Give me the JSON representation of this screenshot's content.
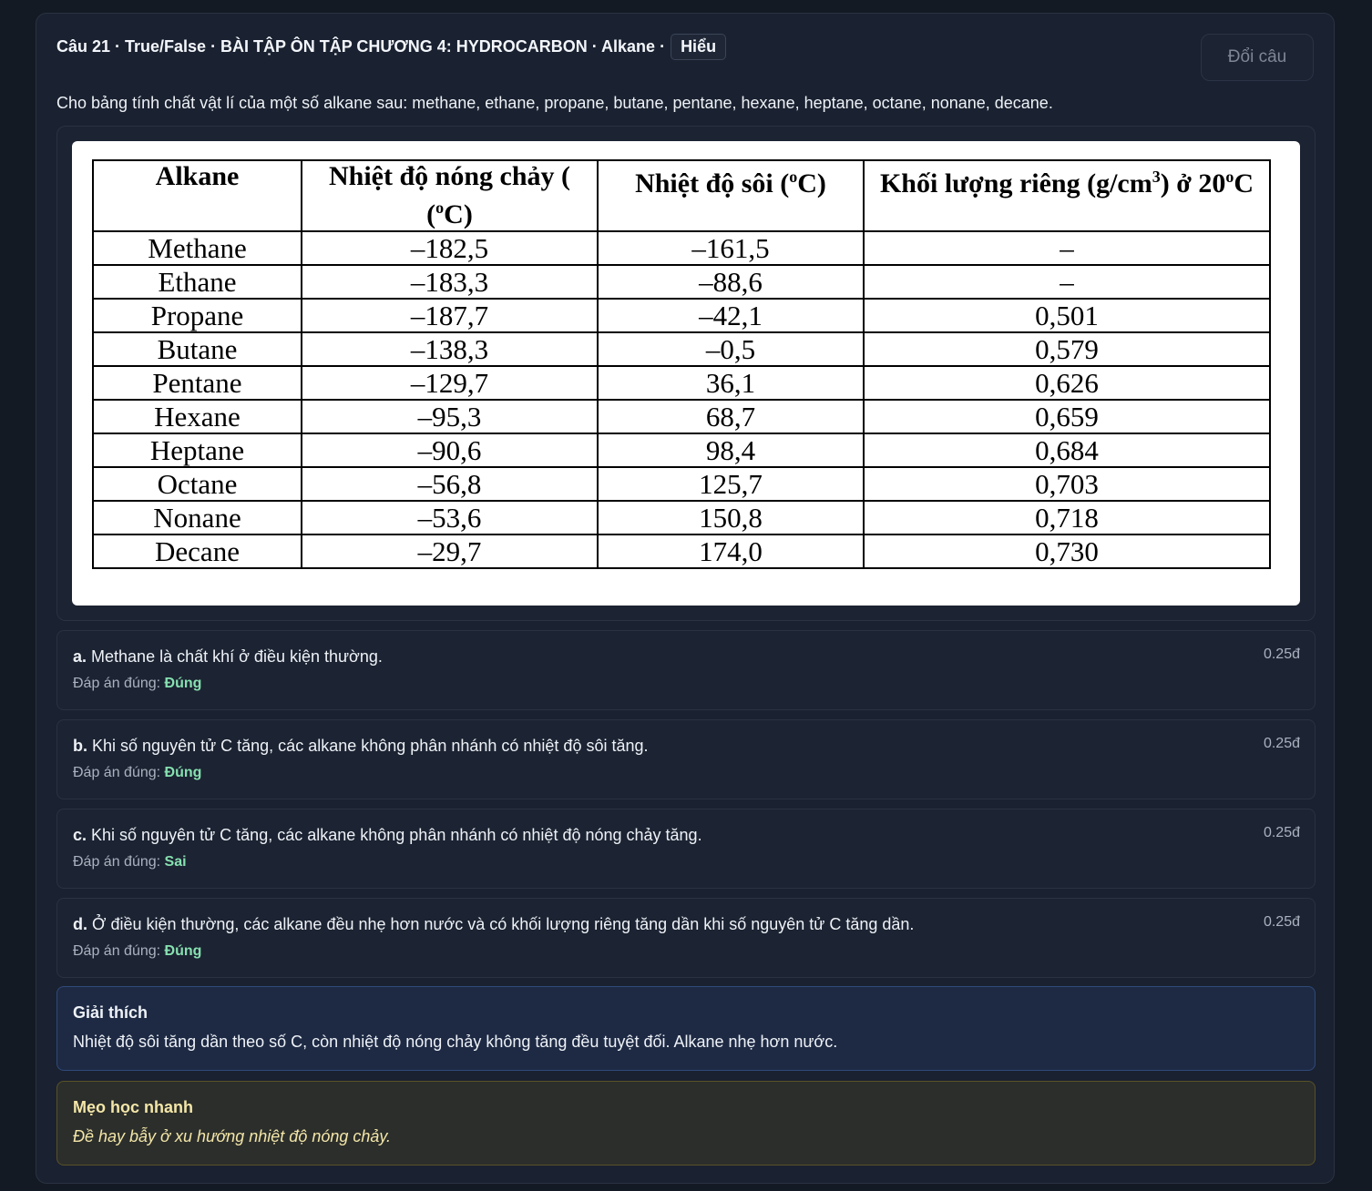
{
  "header": {
    "title": "Câu 21 · True/False · BÀI TẬP ÔN TẬP CHƯƠNG 4: HYDROCARBON · Alkane ·",
    "level_badge": "Hiểu",
    "swap_button": "Đổi câu"
  },
  "prompt": "Cho bảng tính chất vật lí của một số alkane sau: methane, ethane, propane, butane, pentane, hexane, heptane, octane, nonane, decane.",
  "table": {
    "headers": [
      "Alkane",
      "Nhiệt độ nóng chảy (",
      "oC)",
      "Nhiệt độ sôi (",
      "oC)",
      "Khối lượng riêng (g/cm",
      "3",
      ") ở 20",
      "o",
      "C"
    ],
    "rows": [
      [
        "Methane",
        "–182,5",
        "–161,5",
        "–"
      ],
      [
        "Ethane",
        "–183,3",
        "–88,6",
        "–"
      ],
      [
        "Propane",
        "–187,7",
        "–42,1",
        "0,501"
      ],
      [
        "Butane",
        "–138,3",
        "–0,5",
        "0,579"
      ],
      [
        "Pentane",
        "–129,7",
        "36,1",
        "0,626"
      ],
      [
        "Hexane",
        "–95,3",
        "68,7",
        "0,659"
      ],
      [
        "Heptane",
        "–90,6",
        "98,4",
        "0,684"
      ],
      [
        "Octane",
        "–56,8",
        "125,7",
        "0,703"
      ],
      [
        "Nonane",
        "–53,6",
        "150,8",
        "0,718"
      ],
      [
        "Decane",
        "–29,7",
        "174,0",
        "0,730"
      ]
    ]
  },
  "statements": [
    {
      "letter": "a.",
      "text": "Methane là chất khí ở điều kiện thường.",
      "answer_label": "Đáp án đúng:",
      "answer": "Đúng",
      "points": "0.25đ"
    },
    {
      "letter": "b.",
      "text": "Khi số nguyên tử C tăng, các alkane không phân nhánh có nhiệt độ sôi tăng.",
      "answer_label": "Đáp án đúng:",
      "answer": "Đúng",
      "points": "0.25đ"
    },
    {
      "letter": "c.",
      "text": "Khi số nguyên tử C tăng, các alkane không phân nhánh có nhiệt độ nóng chảy tăng.",
      "answer_label": "Đáp án đúng:",
      "answer": "Sai",
      "points": "0.25đ"
    },
    {
      "letter": "d.",
      "text": "Ở điều kiện thường, các alkane đều nhẹ hơn nước và có khối lượng riêng tăng dần khi số nguyên tử C tăng dần.",
      "answer_label": "Đáp án đúng:",
      "answer": "Đúng",
      "points": "0.25đ"
    }
  ],
  "explanation": {
    "title": "Giải thích",
    "body": "Nhiệt độ sôi tăng dần theo số C, còn nhiệt độ nóng chảy không tăng đều tuyệt đối. Alkane nhẹ hơn nước."
  },
  "tip": {
    "title": "Mẹo học nhanh",
    "body": "Đề hay bẫy ở xu hướng nhiệt độ nóng chảy."
  }
}
